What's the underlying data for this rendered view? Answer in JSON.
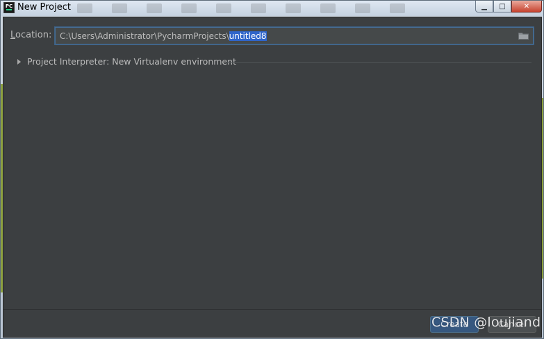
{
  "window": {
    "title": "New Project",
    "app_icon_text": "PC",
    "minimize_glyph": "▁",
    "maximize_glyph": "□",
    "close_glyph": "✕"
  },
  "location": {
    "label": "Location:",
    "label_prefix": "",
    "label_accel": "L",
    "label_rest": "ocation:",
    "path_prefix": "C:\\Users\\Administrator\\PycharmProjects\\",
    "path_selected": "untitled8",
    "browse_icon": "folder-icon"
  },
  "interpreter": {
    "label": "Project Interpreter: New Virtualenv environment",
    "expand_icon": "triangle-right-icon"
  },
  "footer": {
    "create_label": "Create",
    "cancel_label": "Cancel"
  },
  "watermark": {
    "text": "CSDN @loujiand"
  },
  "colors": {
    "dialog_bg": "#3c3f41",
    "field_bg": "#45494a",
    "selection": "#2f65ca",
    "text": "#bbbbbb"
  }
}
